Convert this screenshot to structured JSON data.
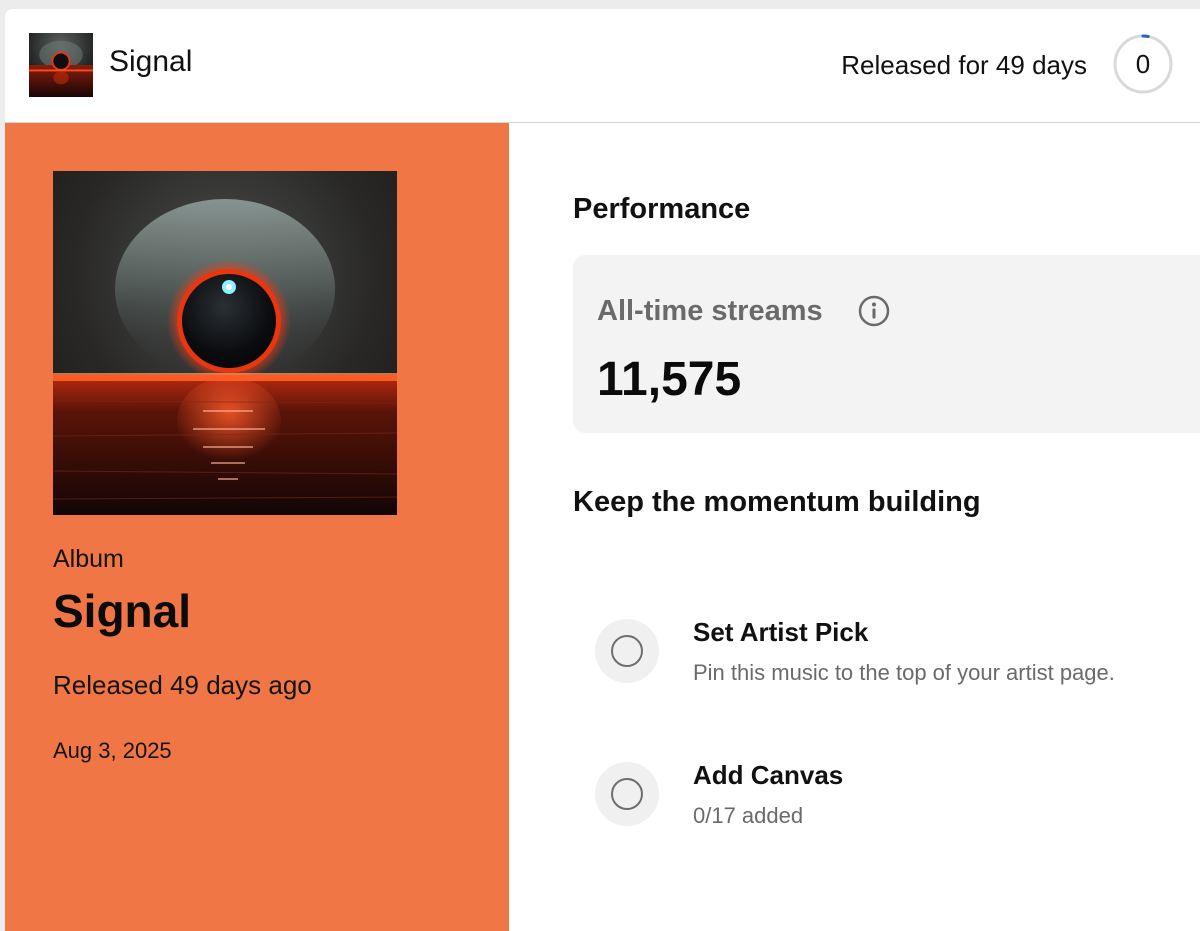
{
  "header": {
    "title": "Signal",
    "release_status": "Released for 49 days",
    "tasks_completed": "0",
    "tasks_progress_fraction": 0.03
  },
  "release": {
    "type": "Album",
    "title": "Signal",
    "released_ago": "Released 49 days ago",
    "release_date": "Aug 3, 2025"
  },
  "performance": {
    "section_title": "Performance",
    "streams_label": "All-time streams",
    "streams_value": "11,575"
  },
  "momentum": {
    "section_title": "Keep the momentum building",
    "tasks": [
      {
        "title": "Set Artist Pick",
        "description": "Pin this music to the top of your artist page.",
        "completed": false
      },
      {
        "title": "Add Canvas",
        "description": "0/17 added",
        "completed": false
      }
    ]
  },
  "icons": {
    "info": "info-icon",
    "task_check": "empty-circle-icon",
    "cover": "album-art"
  },
  "colors": {
    "panel": "#f07645",
    "progress_accent": "#1f66c2",
    "card_bg": "#f3f3f3"
  }
}
